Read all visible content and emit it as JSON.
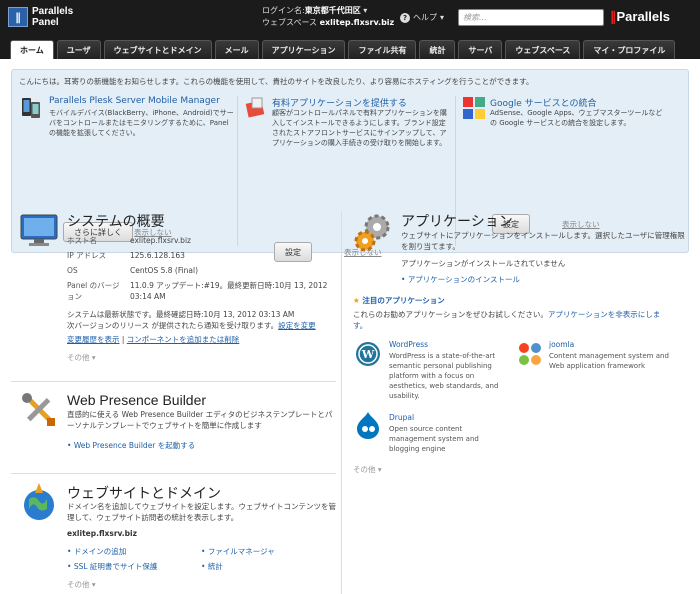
{
  "header": {
    "logo_line1": "Parallels",
    "logo_line2": "Panel",
    "login_label": "ログイン名:",
    "login_name": "東京都千代田区",
    "webspace_label": "ウェブスペース",
    "webspace": "exlitep.flxsrv.biz",
    "help": "ヘルプ",
    "search_placeholder": "検索...",
    "brand": "Parallels"
  },
  "tabs": [
    "ホーム",
    "ユーザ",
    "ウェブサイトとドメイン",
    "メール",
    "アプリケーション",
    "ファイル共有",
    "統計",
    "サーバ",
    "ウェブスペース",
    "マイ・プロファイル"
  ],
  "promo": {
    "intro": "こんにちは。耳寄りの新機能をお知らせします。これらの機能を使用して、貴社のサイトを改良したり、より容易にホスティングを行うことができます。",
    "items": [
      {
        "title": "Parallels Plesk Server Mobile Manager",
        "desc": "モバイルデバイス(BlackBerry、iPhone、Android)でサーバをコントロールまたはモニタリングするために、Panel の機能を拡張してください。",
        "button": "さらに詳しく",
        "hide": "表示しない"
      },
      {
        "title": "有料アプリケーションを提供する",
        "desc": "顧客がコントロールパネルで有料アプリケーションを購入してインストールできるようにします。ブランド設定されたストアフロントサービスにサインアップして、アプリケーションの購入手続きの受け取りを開始します。",
        "button": "設定",
        "hide": "表示しない"
      },
      {
        "title": "Google サービスとの統合",
        "desc": "AdSense、Google Apps、ウェブマスターツールなどの Google サービスとの統合を設定します。",
        "button": "設定",
        "hide": "表示しない"
      }
    ]
  },
  "system": {
    "title": "システムの概要",
    "rows": [
      {
        "k": "ホスト名",
        "v": "exlitep.flxsrv.biz"
      },
      {
        "k": "IP アドレス",
        "v": "125.6.128.163"
      },
      {
        "k": "OS",
        "v": "CentOS 5.8 (Final)"
      },
      {
        "k": "Panel のバージョン",
        "v": "11.0.9 アップデート:#19。最終更新日時:10月 13, 2012 03:14 AM"
      }
    ],
    "status": "システムは最新状態です。最終確認日時:10月 13, 2012 03:13 AM",
    "notify": "次バージョンのリリース が提供されたら通知を受け取ります。",
    "notify_link": "設定を変更",
    "history": "変更履歴を表示",
    "components": "コンポーネントを追加または削除",
    "more": "その他 ▾"
  },
  "wpb": {
    "title": "Web Presence Builder",
    "desc": "直感的に使える Web Presence Builder エディタのビジネステンプレートとパーソナルテンプレートでウェブサイトを簡単に作成します",
    "link": "Web Presence Builder を起動する"
  },
  "websites": {
    "title": "ウェブサイトとドメイン",
    "desc": "ドメイン名を追加してウェブサイトを設定します。ウェブサイトコンテンツを管理して、ウェブサイト訪問者の統計を表示します。",
    "domain": "exlitep.flxsrv.biz",
    "links": [
      "ドメインの追加",
      "ファイルマネージャ",
      "SSL 証明書でサイト保護",
      "統計"
    ],
    "more": "その他 ▾"
  },
  "apps": {
    "title": "アプリケーション",
    "desc": "ウェブサイトにアプリケーションをインストールします。選択したユーザに管理権限を割り当てます。",
    "none": "アプリケーションがインストールされていません",
    "install": "アプリケーションのインストール",
    "featured_title": "注目のアプリケーション",
    "featured_desc": "これらのお勧めアプリケーションをぜひお試しください。",
    "hide_link": "アプリケーションを非表示にします。",
    "items": [
      {
        "name": "WordPress",
        "desc": "WordPress is a state-of-the-art semantic personal publishing platform with a focus on aesthetics, web standards, and usability."
      },
      {
        "name": "joomla",
        "desc": "Content management system and Web application framework"
      },
      {
        "name": "Drupal",
        "desc": "Open source content management system and blogging engine"
      }
    ],
    "more": "その他 ▾"
  }
}
